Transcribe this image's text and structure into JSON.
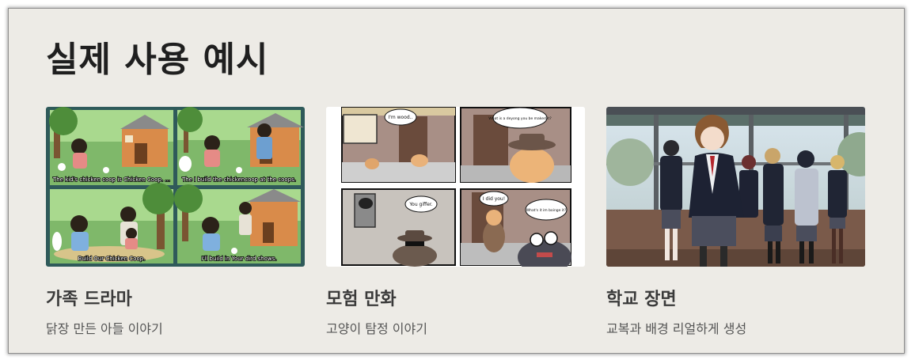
{
  "section": {
    "title": "실제 사용 예시"
  },
  "cards": [
    {
      "title": "가족 드라마",
      "description": "닭장 만든 아들 이야기",
      "image": "family-drama-comic-image",
      "captions": [
        "The kid's chicken coop is Chicken Coop. ...",
        "The I build the chickencoop at the coops.",
        "Build Our Chicken Coop.",
        "I'll build in Your dird shows."
      ]
    },
    {
      "title": "모험 만화",
      "description": "고양이 탐정 이야기",
      "image": "adventure-comic-image",
      "bubbles": [
        "I'm wood..",
        "What is a deyong you be maked it?",
        "You giffer.",
        "I did you!",
        "What's it im boinge it?"
      ]
    },
    {
      "title": "학교 장면",
      "description": "교복과 배경 리얼하게 생성",
      "image": "school-scene-image"
    }
  ]
}
